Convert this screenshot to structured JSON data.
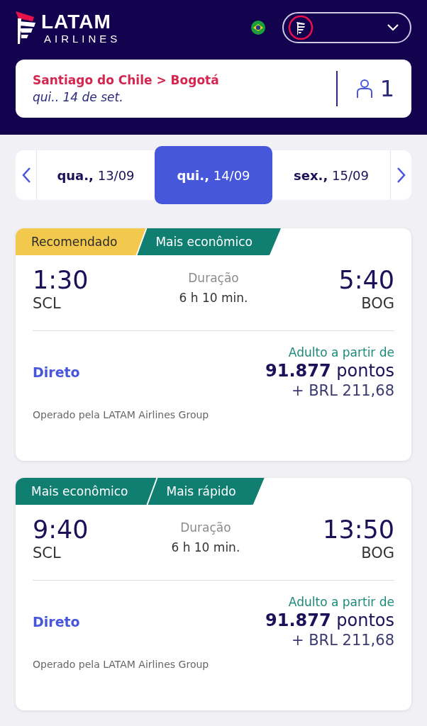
{
  "header": {
    "logo_text": "LATAM",
    "logo_subtext": "AIRLINES"
  },
  "search_summary": {
    "route": "Santiago do Chile > Bogotá",
    "date": "qui.. 14 de set.",
    "passengers": "1"
  },
  "dates": [
    {
      "day": "qua.,",
      "date": "13/09",
      "selected": false
    },
    {
      "day": "qui.,",
      "date": "14/09",
      "selected": true
    },
    {
      "day": "sex.,",
      "date": "15/09",
      "selected": false
    }
  ],
  "flights": [
    {
      "tags": [
        {
          "label": "Recomendado",
          "kind": "recommended"
        },
        {
          "label": "Mais econômico",
          "kind": "economic"
        }
      ],
      "departure_time": "1:30",
      "departure_airport": "SCL",
      "duration_label": "Duração",
      "duration": "6 h 10 min.",
      "arrival_time": "5:40",
      "arrival_airport": "BOG",
      "stops": "Direto",
      "fare_label": "Adulto a partir de",
      "points": "91.877",
      "points_unit": "pontos",
      "fee": "+ BRL 211,68",
      "operator": "Operado pela LATAM Airlines Group"
    },
    {
      "tags": [
        {
          "label": "Mais econômico",
          "kind": "economic"
        },
        {
          "label": "Mais rápido",
          "kind": "fastest"
        }
      ],
      "departure_time": "9:40",
      "departure_airport": "SCL",
      "duration_label": "Duração",
      "duration": "6 h 10 min.",
      "arrival_time": "13:50",
      "arrival_airport": "BOG",
      "stops": "Direto",
      "fare_label": "Adulto a partir de",
      "points": "91.877",
      "points_unit": "pontos",
      "fee": "+ BRL 211,68",
      "operator": "Operado pela LATAM Airlines Group"
    }
  ]
}
